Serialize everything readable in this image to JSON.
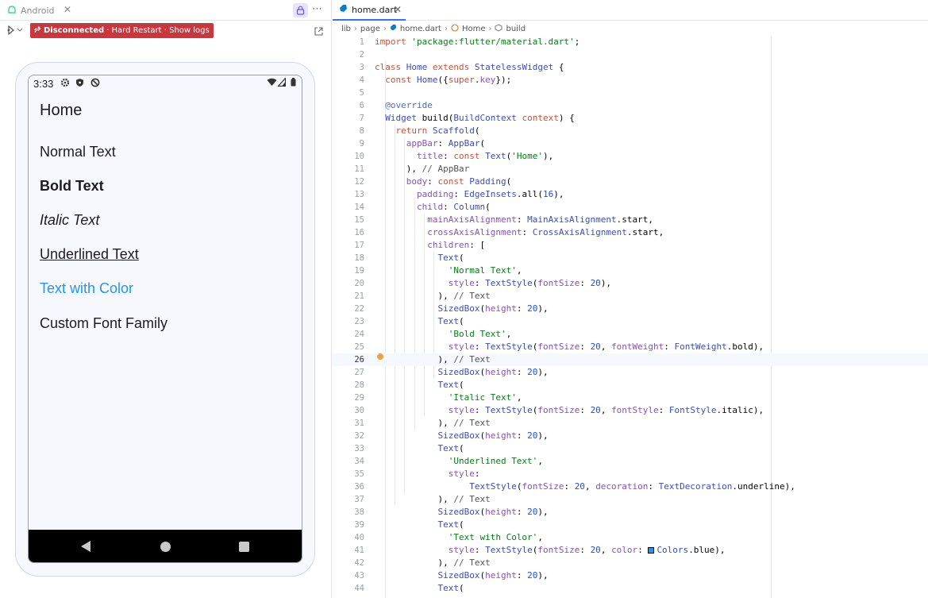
{
  "left_panel": {
    "tab_label": "Android",
    "status_badge": {
      "state": "Disconnected",
      "actions": "· Hard Restart · Show logs"
    }
  },
  "device": {
    "status_time": "3:33",
    "app_title": "Home",
    "texts": [
      "Normal Text",
      "Bold Text",
      "Italic Text",
      "Underlined Text",
      "Text with Color",
      "Custom Font Family"
    ],
    "text_color_accent": "#2196f3"
  },
  "editor": {
    "tab_label": "home.dart",
    "breadcrumb": [
      "lib",
      "page",
      "home.dart",
      "Home",
      "build"
    ],
    "current_line": 26,
    "lines": [
      {
        "n": "1",
        "code": "import 'package:flutter/material.dart';"
      },
      {
        "n": "2",
        "code": ""
      },
      {
        "n": "3",
        "code": "class Home extends StatelessWidget {"
      },
      {
        "n": "4",
        "code": "  const Home({super.key});"
      },
      {
        "n": "5",
        "code": ""
      },
      {
        "n": "6",
        "code": "  @override"
      },
      {
        "n": "7",
        "code": "  Widget build(BuildContext context) {"
      },
      {
        "n": "8",
        "code": "    return Scaffold("
      },
      {
        "n": "9",
        "code": "      appBar: AppBar("
      },
      {
        "n": "10",
        "code": "        title: const Text('Home'),"
      },
      {
        "n": "11",
        "code": "      ), // AppBar"
      },
      {
        "n": "12",
        "code": "      body: const Padding("
      },
      {
        "n": "13",
        "code": "        padding: EdgeInsets.all(16),"
      },
      {
        "n": "14",
        "code": "        child: Column("
      },
      {
        "n": "15",
        "code": "          mainAxisAlignment: MainAxisAlignment.start,"
      },
      {
        "n": "16",
        "code": "          crossAxisAlignment: CrossAxisAlignment.start,"
      },
      {
        "n": "17",
        "code": "          children: ["
      },
      {
        "n": "18",
        "code": "            Text("
      },
      {
        "n": "19",
        "code": "              'Normal Text',"
      },
      {
        "n": "20",
        "code": "              style: TextStyle(fontSize: 20),"
      },
      {
        "n": "21",
        "code": "            ), // Text"
      },
      {
        "n": "22",
        "code": "            SizedBox(height: 20),"
      },
      {
        "n": "23",
        "code": "            Text("
      },
      {
        "n": "24",
        "code": "              'Bold Text',"
      },
      {
        "n": "25",
        "code": "              style: TextStyle(fontSize: 20, fontWeight: FontWeight.bold),"
      },
      {
        "n": "26",
        "code": "            ), // Text"
      },
      {
        "n": "27",
        "code": "            SizedBox(height: 20),"
      },
      {
        "n": "28",
        "code": "            Text("
      },
      {
        "n": "29",
        "code": "              'Italic Text',"
      },
      {
        "n": "30",
        "code": "              style: TextStyle(fontSize: 20, fontStyle: FontStyle.italic),"
      },
      {
        "n": "31",
        "code": "            ), // Text"
      },
      {
        "n": "32",
        "code": "            SizedBox(height: 20),"
      },
      {
        "n": "33",
        "code": "            Text("
      },
      {
        "n": "34",
        "code": "              'Underlined Text',"
      },
      {
        "n": "35",
        "code": "              style:"
      },
      {
        "n": "36",
        "code": "                  TextStyle(fontSize: 20, decoration: TextDecoration.underline),"
      },
      {
        "n": "37",
        "code": "            ), // Text"
      },
      {
        "n": "38",
        "code": "            SizedBox(height: 20),"
      },
      {
        "n": "39",
        "code": "            Text("
      },
      {
        "n": "40",
        "code": "              'Text with Color',"
      },
      {
        "n": "41",
        "code": "              style: TextStyle(fontSize: 20, color: Colors.blue),"
      },
      {
        "n": "42",
        "code": "            ), // Text"
      },
      {
        "n": "43",
        "code": "            SizedBox(height: 20),"
      },
      {
        "n": "44",
        "code": "            Text("
      }
    ]
  },
  "colors": {
    "badge_bg": "#c9373c",
    "accent_tab": "#3574f0",
    "blue_text": "#2196f3"
  }
}
